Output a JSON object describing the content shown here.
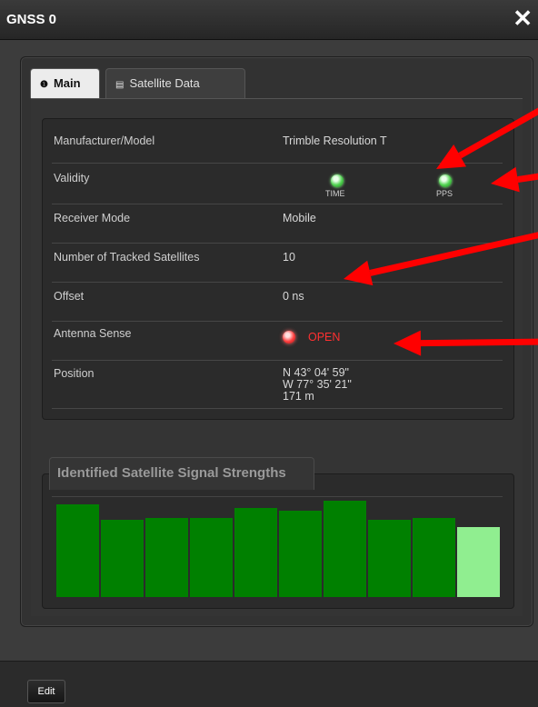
{
  "window": {
    "title": "GNSS 0",
    "close_glyph": "✕"
  },
  "tabs": [
    {
      "label": "Main",
      "icon": "info-icon",
      "active": true
    },
    {
      "label": "Satellite Data",
      "icon": "chart-icon",
      "active": false
    }
  ],
  "info": {
    "manufacturer": {
      "label": "Manufacturer/Model",
      "value": "Trimble Resolution T"
    },
    "validity": {
      "label": "Validity",
      "time": "TIME",
      "pps": "PPS",
      "time_status": "green",
      "pps_status": "green"
    },
    "receiver_mode": {
      "label": "Receiver Mode",
      "value": "Mobile"
    },
    "tracked": {
      "label": "Number of Tracked Satellites",
      "value": "10"
    },
    "offset": {
      "label": "Offset",
      "value": "0 ns"
    },
    "antenna": {
      "label": "Antenna Sense",
      "value": "OPEN",
      "status": "red"
    },
    "position": {
      "label": "Position",
      "lat": "N 43° 04' 59\"",
      "lon": "W 77° 35' 21\"",
      "alt": "171 m"
    }
  },
  "signal": {
    "title": "Identified Satellite Signal Strengths",
    "bar_levels": [
      1.0,
      0.83,
      0.85,
      0.85,
      0.96,
      0.93,
      1.04,
      0.83,
      0.85,
      0.75
    ],
    "colors": {
      "strong": "#008000",
      "weak": "#90ee90"
    },
    "weak_index": 9
  },
  "footer": {
    "edit_label": "Edit"
  },
  "annotation_color": "#ff0000"
}
